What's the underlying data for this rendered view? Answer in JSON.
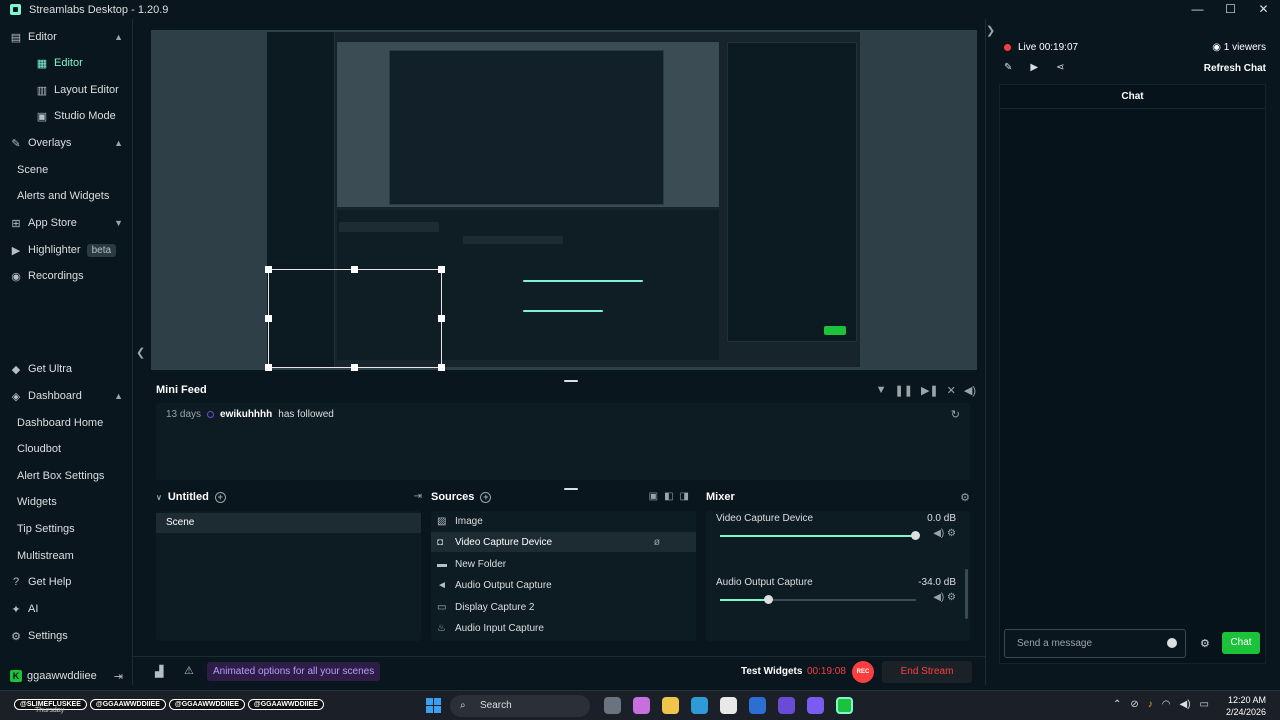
{
  "app": {
    "title": "Streamlabs Desktop - 1.20.9"
  },
  "window_controls": {
    "minimize": "—",
    "maximize": "☐",
    "close": "✕"
  },
  "sidebar": {
    "items": [
      {
        "label": "Editor",
        "icon": "editor-icon",
        "group": true
      },
      {
        "label": "Editor",
        "icon": "editor-grid-icon",
        "active": true
      },
      {
        "label": "Layout Editor",
        "icon": "layout-icon"
      },
      {
        "label": "Studio Mode",
        "icon": "studio-icon"
      },
      {
        "label": "Overlays",
        "icon": "overlays-icon",
        "group": true
      },
      {
        "label": "Scene"
      },
      {
        "label": "Alerts and Widgets"
      },
      {
        "label": "App Store",
        "icon": "app-store-icon",
        "group": true
      },
      {
        "label": "Highlighter",
        "icon": "highlighter-icon",
        "badge": "beta"
      },
      {
        "label": "Recordings",
        "icon": "recordings-icon"
      },
      {
        "label": "Get Ultra",
        "icon": "ultra-icon"
      },
      {
        "label": "Dashboard",
        "icon": "dashboard-icon",
        "group": true
      },
      {
        "label": "Dashboard Home"
      },
      {
        "label": "Cloudbot"
      },
      {
        "label": "Alert Box Settings"
      },
      {
        "label": "Widgets"
      },
      {
        "label": "Tip Settings"
      },
      {
        "label": "Multistream"
      },
      {
        "label": "Get Help",
        "icon": "help-icon"
      },
      {
        "label": "AI",
        "icon": "ai-icon"
      },
      {
        "label": "Settings",
        "icon": "settings-icon"
      }
    ],
    "user": {
      "name": "ggaawwddiiee",
      "logout_icon": "logout-icon"
    }
  },
  "minifeed": {
    "title": "Mini Feed",
    "events": [
      {
        "ago": "13 days",
        "user": "ewikuhhhh",
        "action": "has followed"
      }
    ]
  },
  "scenes": {
    "title": "Untitled",
    "items": [
      "Scene"
    ]
  },
  "sources": {
    "title": "Sources",
    "items": [
      {
        "label": "Image",
        "icon": "image-icon"
      },
      {
        "label": "Video Capture Device",
        "icon": "camera-icon",
        "selected": true
      },
      {
        "label": "New Folder",
        "icon": "folder-icon"
      },
      {
        "label": "Audio Output Capture",
        "icon": "speaker-icon"
      },
      {
        "label": "Display Capture 2",
        "icon": "monitor-icon"
      },
      {
        "label": "Audio Input Capture",
        "icon": "mic-icon"
      }
    ]
  },
  "mixer": {
    "title": "Mixer",
    "channels": [
      {
        "name": "Video Capture Device",
        "db": "0.0 dB",
        "level": 1.0
      },
      {
        "name": "Audio Output Capture",
        "db": "-34.0 dB",
        "level": 0.25
      }
    ]
  },
  "footer": {
    "animated_label": "Animated options for all your scenes",
    "test_widgets": "Test Widgets",
    "timer": "00:19:08",
    "rec": "REC",
    "end_stream": "End Stream"
  },
  "chat": {
    "live_label": "Live",
    "live_time": "00:19:07",
    "viewers": "1 viewers",
    "refresh": "Refresh Chat",
    "header": "Chat",
    "input_placeholder": "Send a message",
    "send_label": "Chat"
  },
  "taskbar": {
    "stream_chips": [
      "@SLIMEFLUSKEE",
      "@GGAAWWDDIIEE",
      "@GGAAWWDDIIEE",
      "@GGAAWWDDIIEE"
    ],
    "under_text": "Thursday",
    "search_label": "Search",
    "time": "12:20 AM",
    "date": "2/24/2026"
  },
  "colors": {
    "accent": "#80f5d2",
    "live": "#fc3e3f",
    "chat_button": "#1dc23b",
    "bg": "#09161d"
  }
}
